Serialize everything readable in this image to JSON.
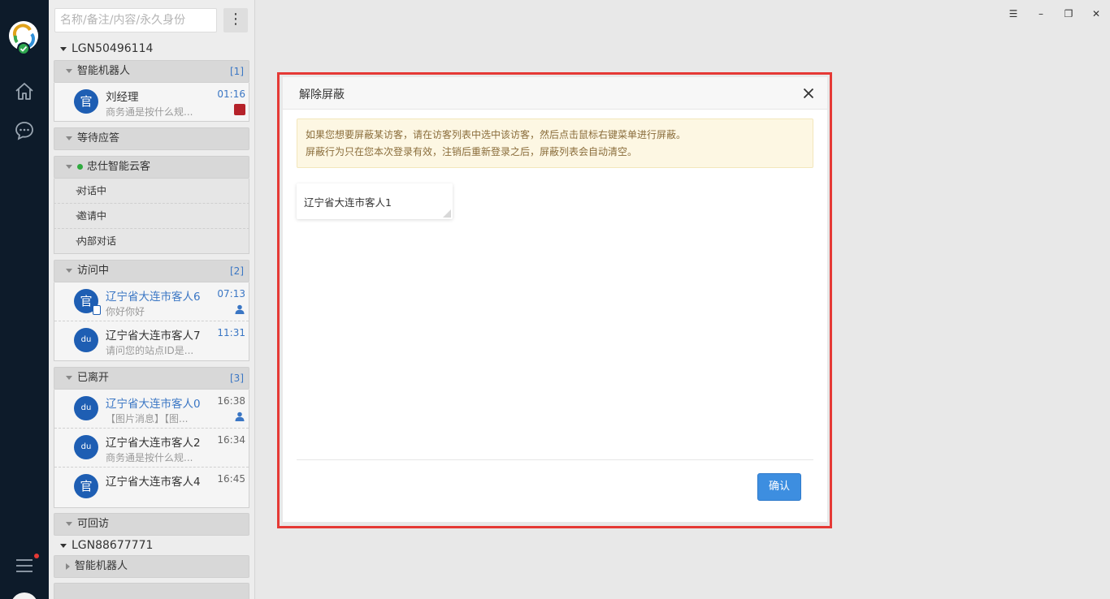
{
  "sidebar_search": {
    "placeholder": "名称/备注/内容/永久身份"
  },
  "accounts": [
    {
      "id": "LGN50496114",
      "sections": {
        "robot": {
          "label": "智能机器人",
          "count": "[1]"
        },
        "waiting": {
          "label": "等待应答"
        },
        "cloud": {
          "label": "忠仕智能云客",
          "subsections": [
            "对话中",
            "邀请中",
            "内部对话"
          ]
        },
        "visiting": {
          "label": "访问中",
          "count": "[2]"
        },
        "left": {
          "label": "已离开",
          "count": "[3]"
        },
        "revisit": {
          "label": "可回访"
        }
      }
    },
    {
      "id": "LGN88677771",
      "sections": {
        "robot": {
          "label": "智能机器人"
        }
      }
    }
  ],
  "robot_items": [
    {
      "avatar": "官",
      "name": "刘经理",
      "preview": "商务通是按什么规...",
      "time": "01:16"
    }
  ],
  "visiting_items": [
    {
      "avatar": "官",
      "name": "辽宁省大连市客人6",
      "preview": "你好你好",
      "time": "07:13"
    },
    {
      "avatar": "du",
      "name": "辽宁省大连市客人7",
      "preview": "请问您的站点ID是...",
      "time": "11:31"
    }
  ],
  "left_items": [
    {
      "avatar": "du",
      "name": "辽宁省大连市客人0",
      "preview": "【图片消息】【图...",
      "time": "16:38"
    },
    {
      "avatar": "du",
      "name": "辽宁省大连市客人2",
      "preview": "商务通是按什么规...",
      "time": "16:34"
    },
    {
      "avatar": "官",
      "name": "辽宁省大连市客人4",
      "preview": "",
      "time": "16:45"
    }
  ],
  "window_controls": {
    "menu": "☰",
    "minimize": "–",
    "restore": "❐",
    "close": "✕"
  },
  "icons": [
    "app-logo-icon",
    "home-icon",
    "chat-icon",
    "hamburger-icon",
    "user-icon",
    "close-icon",
    "resize-handle-icon"
  ],
  "colors": {
    "rail": "#0d1b2a",
    "accent_blue": "#3a76c4",
    "avatar_blue": "#1e5eb3",
    "highlight_red": "#e53935",
    "confirm_button": "#3d8ee0"
  },
  "modal": {
    "title": "解除屏蔽",
    "notice_line1": "如果您想要屏蔽某访客，请在访客列表中选中该访客，然后点击鼠标右键菜单进行屏蔽。",
    "notice_line2": "屏蔽行为只在您本次登录有效，注销后重新登录之后，屏蔽列表会自动清空。",
    "blocked_visitor": "辽宁省大连市客人1",
    "confirm_label": "确认"
  }
}
